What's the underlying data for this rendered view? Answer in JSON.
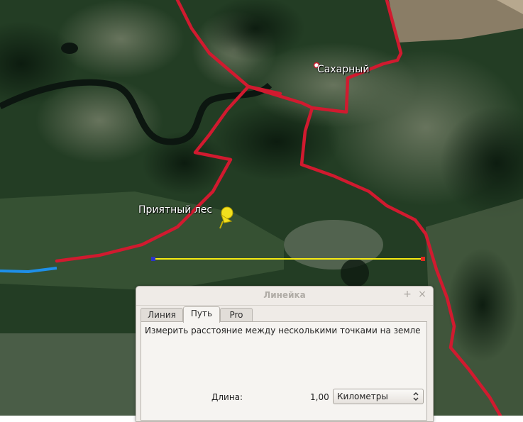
{
  "map": {
    "places": [
      {
        "name": "Сахарный"
      },
      {
        "name": "Приятный лес"
      }
    ],
    "colors": {
      "roads": "#d11a2f",
      "ruler_line": "#f5ea12",
      "river": "#1e8fe8",
      "forest": "#1f3a20"
    }
  },
  "ruler": {
    "title": "Линейка",
    "window_buttons": {
      "pin": "+",
      "close": "×"
    },
    "tabs": [
      {
        "label": "Линия",
        "active": false
      },
      {
        "label": "Путь",
        "active": true
      },
      {
        "label": "Pro",
        "active": false
      }
    ],
    "description": "Измерить расстояние между несколькими точками на земле",
    "length_label": "Длина:",
    "length_value": "1,00",
    "units": "Километры"
  }
}
